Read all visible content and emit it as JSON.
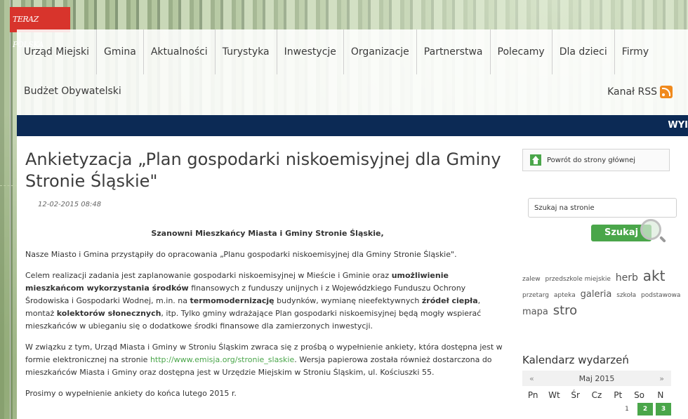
{
  "badge": {
    "text": "TERAZ POLSKA"
  },
  "nav": {
    "items": [
      "Urząd Miejski",
      "Gmina",
      "Aktualności",
      "Turystyka",
      "Inwestycje",
      "Organizacje",
      "Partnerstwa",
      "Polecamy",
      "Dla dzieci",
      "Firmy"
    ],
    "row2": "Budżet Obywatelski",
    "rss": "Kanał RSS"
  },
  "ticker": {
    "text": "WYI"
  },
  "article": {
    "title": "Ankietyzacja „Plan gospodarki niskoemisyjnej dla Gminy Stronie Śląskie\"",
    "date": "12-02-2015 08:48",
    "greeting": "Szanowni Mieszkańcy Miasta i Gminy Stronie Śląskie,",
    "p1": "Nasze Miasto i Gmina przystąpiły do opracowania „Planu gospodarki niskoemisyjnej dla Gminy Stronie Śląskie\".",
    "p2": {
      "a": "Celem realizacji zadania jest zaplanowanie gospodarki niskoemisyjnej w Mieście i Gminie oraz ",
      "b": "umożliwienie mieszkańcom wykorzystania środków",
      "c": " finansowych z funduszy unijnych i z Wojewódzkiego Funduszu Ochrony Środowiska i Gospodarki Wodnej, m.in. na ",
      "d": "termomodernizację",
      "e": " budynków, wymianę nieefektywnych ",
      "f": "źródeł ciepła",
      "g": ", montaż ",
      "h": "kolektorów słonecznych",
      "i": ", itp. Tylko gminy wdrażające Plan gospodarki niskoemisyjnej będą mogły wspierać mieszkańców w ubieganiu się o dodatkowe środki finansowe dla zamierzonych inwestycji."
    },
    "p3": {
      "a": "W związku z tym, Urząd Miasta i Gminy w Stroniu Śląskim zwraca się z prośbą o wypełnienie ankiety, która dostępna jest w formie elektronicznej na stronie ",
      "link": "http://www.emisja.org/stronie_slaskie",
      "b": ". Wersja papierowa została również dostarczona do mieszkańców Miasta i Gminy oraz dostępna jest w Urzędzie Miejskim w Stroniu Śląskim, ul. Kościuszki 55."
    },
    "p4": "Prosimy o wypełnienie ankiety do końca lutego 2015 r."
  },
  "sidebar": {
    "back_label": "Powrót do strony głównej",
    "search_placeholder": "Szukaj na stronie",
    "search_button": "Szukaj",
    "tags": [
      {
        "t": "zalew",
        "c": "t1"
      },
      {
        "t": "przedszkole miejskie",
        "c": "t1"
      },
      {
        "t": "herb",
        "c": "t2"
      },
      {
        "t": "akt",
        "c": "t3"
      },
      {
        "t": "przetarg",
        "c": "t1"
      },
      {
        "t": "apteka",
        "c": "t1"
      },
      {
        "t": "galeria",
        "c": "t5"
      },
      {
        "t": "szkoła",
        "c": "t1"
      },
      {
        "t": "podstawowa",
        "c": "t1"
      },
      {
        "t": "mapa",
        "c": "t5"
      },
      {
        "t": "stro",
        "c": "t4"
      }
    ],
    "calendar": {
      "title": "Kalendarz wydarzeń",
      "prev": "«",
      "month": "Maj 2015",
      "next": "»",
      "days": [
        "Pn",
        "Wt",
        "Śr",
        "Cz",
        "Pt",
        "So",
        "N"
      ],
      "first_row": [
        {
          "n": "1",
          "hi": false
        },
        {
          "n": "2",
          "hi": true
        },
        {
          "n": "3",
          "hi": true
        }
      ]
    }
  }
}
